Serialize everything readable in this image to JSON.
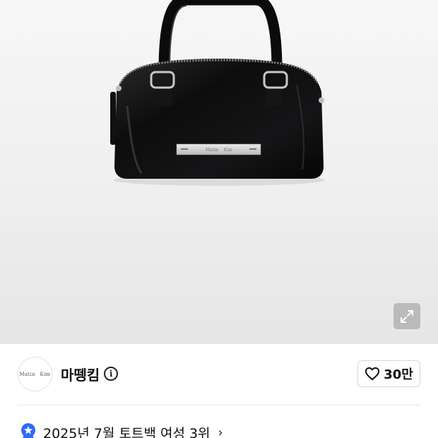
{
  "product": {
    "image": {
      "subject": "black-leather-mini-tote-bag",
      "plate_text": "Matin Kim"
    }
  },
  "brand": {
    "logo_text": "Matin Kim",
    "name": "마뗑킴"
  },
  "like": {
    "count": "30만"
  },
  "ranking": {
    "text": "2025년 7월 토트백 여성 3위"
  },
  "icons": {
    "expand": "expand-arrows-icon",
    "info": "info-icon",
    "heart": "heart-outline-icon",
    "badge": "blue-ribbon-badge-icon",
    "chevron": "chevron-right-icon"
  },
  "colors": {
    "badge_blue": "#2f6cf5",
    "bag_black": "#0b0b0c"
  }
}
